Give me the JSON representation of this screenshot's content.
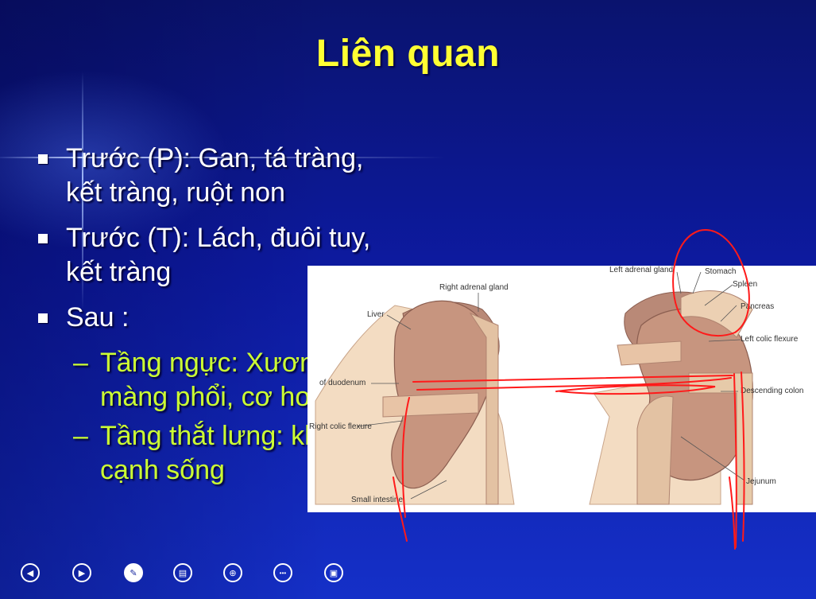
{
  "slide": {
    "title": "Liên quan",
    "bullets": [
      {
        "text": "Trước (P): Gan, tá tràng,\nkết tràng, ruột non"
      },
      {
        "text": "Trước (T): Lách, đuôi tuy,\nkết tràng"
      },
      {
        "text": "Sau :"
      }
    ],
    "sub_bullets": [
      {
        "dash": "–",
        "text": "Tầng ngực: Xương sườn,\nmàng phổi, cơ hoành"
      },
      {
        "dash": "–",
        "text": "Tầng thắt lưng: khối cơ\ncạnh sống"
      }
    ]
  },
  "figure": {
    "labels": {
      "right_adrenal": "Right adrenal gland",
      "liver": "Liver",
      "duodenum": "of duodenum",
      "right_colic": "Right colic flexure",
      "small_intestine": "Small intestine",
      "left_adrenal": "Left adrenal gland",
      "stomach": "Stomach",
      "spleen": "Spleen",
      "pancreas": "Pancreas",
      "left_colic": "Left colic flexure",
      "descending_colon": "Descending colon",
      "jejunum": "Jejunum"
    }
  },
  "nav": {
    "buttons": [
      {
        "name": "previous",
        "glyph": "◀"
      },
      {
        "name": "next",
        "glyph": "▶"
      },
      {
        "name": "pen",
        "glyph": "✎"
      },
      {
        "name": "menu",
        "glyph": "▤"
      },
      {
        "name": "zoom",
        "glyph": "⊕"
      },
      {
        "name": "more",
        "glyph": "•••"
      },
      {
        "name": "display",
        "glyph": "▣"
      }
    ]
  },
  "colors": {
    "title": "#ffff33",
    "bullet_text": "#ffffff",
    "sub_bullet_text": "#ccff33",
    "annotation_ink": "#ff1a1a"
  }
}
